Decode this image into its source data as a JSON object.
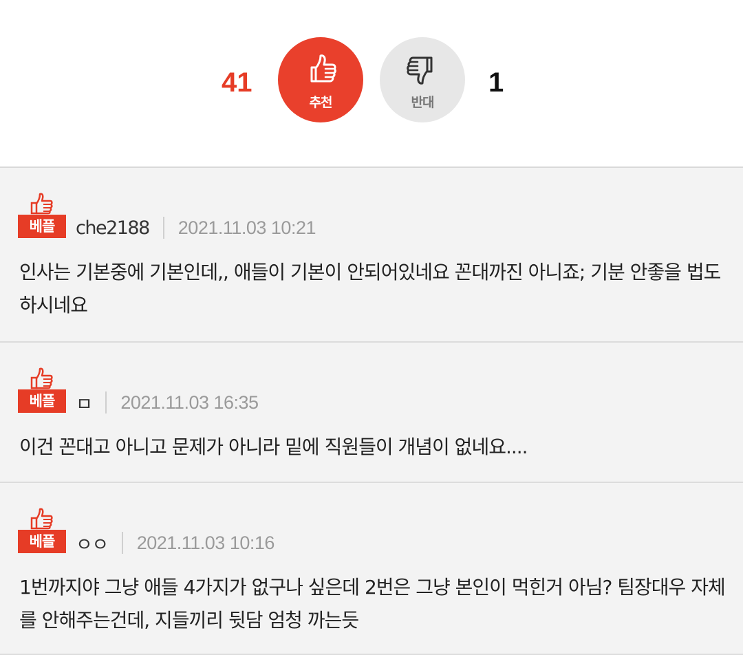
{
  "vote": {
    "up_count": "41",
    "up_label": "추천",
    "down_label": "반대",
    "down_count": "1"
  },
  "colors": {
    "accent": "#e63c26",
    "comment_bg": "#f3f3f3",
    "date": "#9a9a9a"
  },
  "comments": [
    {
      "badge": "베플",
      "user": "che2188",
      "date": "2021.11.03 10:21",
      "text": "인사는 기본중에 기본인데,, 애들이 기본이 안되어있네요 꼰대까진 아니죠; 기분 안좋을 법도 하시네요"
    },
    {
      "badge": "베플",
      "user": "ㅁ",
      "date": "2021.11.03 16:35",
      "text": "이건 꼰대고 아니고 문제가 아니라 밑에 직원들이 개념이 없네요...."
    },
    {
      "badge": "베플",
      "user": "ㅇㅇ",
      "date": "2021.11.03 10:16",
      "text": "1번까지야 그냥 애들 4가지가 없구나 싶은데 2번은 그냥 본인이 먹힌거 아님? 팀장대우 자체를 안해주는건데, 지들끼리 뒷담 엄청 까는듯"
    }
  ]
}
